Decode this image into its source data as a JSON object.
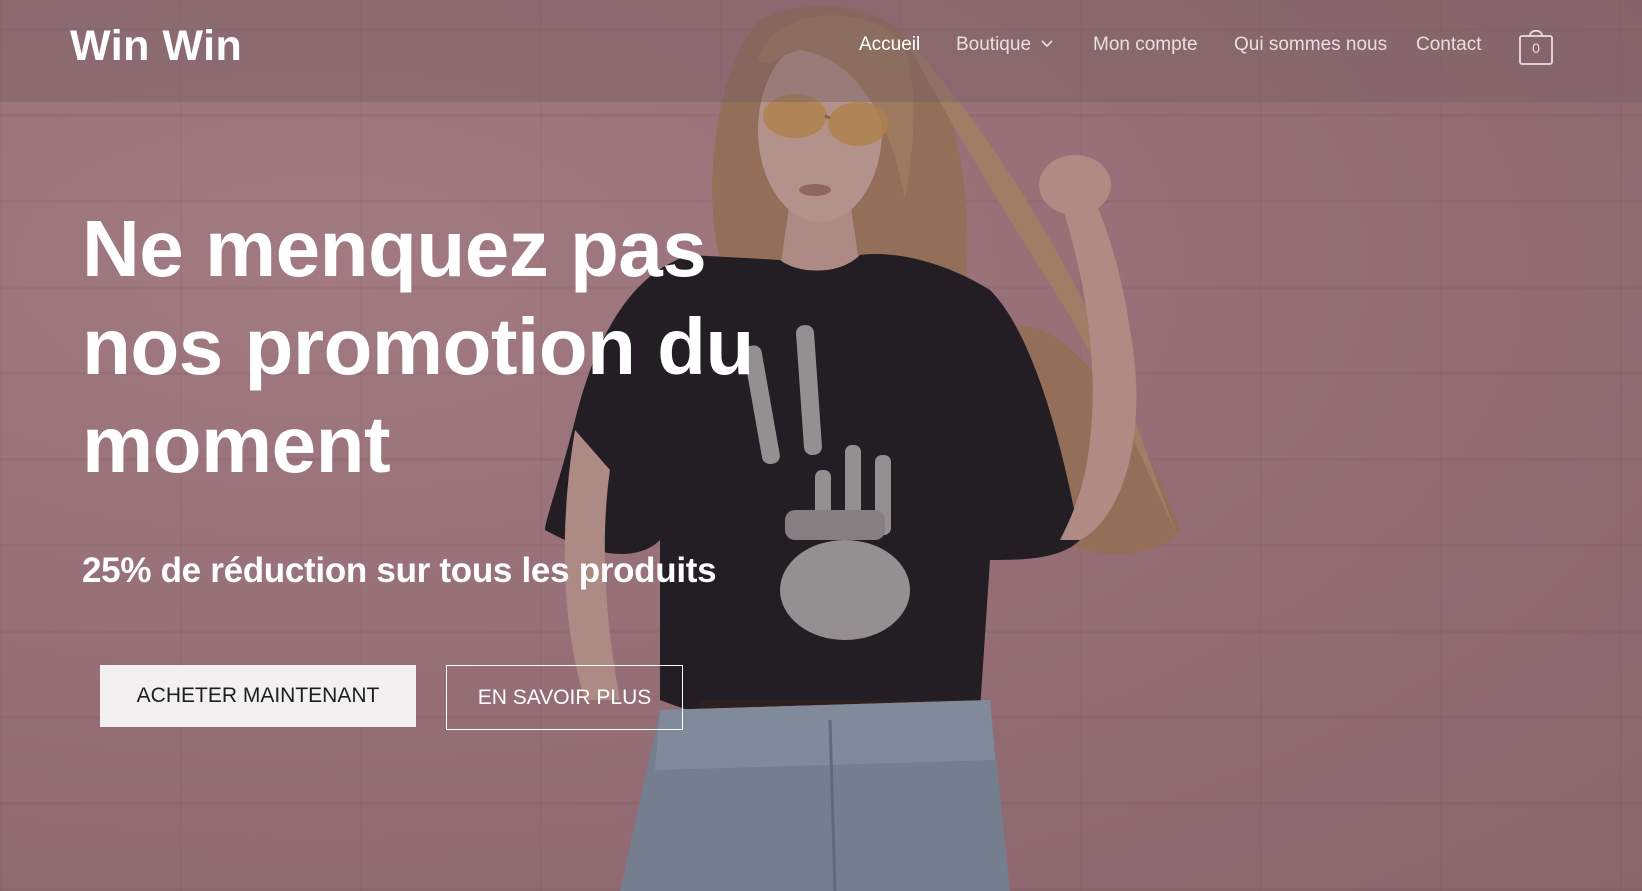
{
  "header": {
    "logo": "Win Win",
    "nav": [
      {
        "label": "Accueil",
        "active": true
      },
      {
        "label": "Boutique",
        "has_dropdown": true
      },
      {
        "label": "Mon compte"
      },
      {
        "label": "Qui sommes nous"
      },
      {
        "label": "Contact"
      }
    ],
    "cart": {
      "count": "0",
      "icon": "shopping-bag-icon"
    }
  },
  "hero": {
    "title_lines": [
      "Ne menquez pas",
      "nos promotion du",
      "moment"
    ],
    "subtitle": "25% de réduction sur tous les produits",
    "primary_button": "ACHETER MAINTENANT",
    "secondary_button": "EN SAVOIR PLUS"
  },
  "colors": {
    "wall": "#b58a91",
    "header_bg": "rgba(120,95,100,0.45)",
    "text": "#ffffff",
    "button_light": "#f2f0f1"
  }
}
